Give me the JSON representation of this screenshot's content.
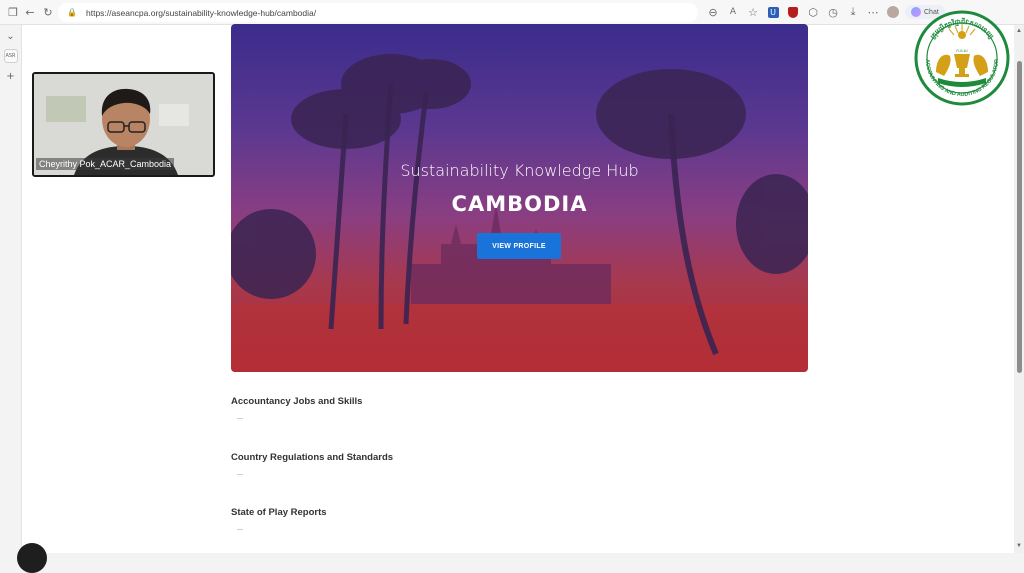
{
  "browser": {
    "url": "https://aseancpa.org/sustainability-knowledge-hub/cambodia/",
    "chat_label": "Chat",
    "toolbar_icons": [
      "tabs-icon",
      "back-icon",
      "refresh-icon",
      "lock-icon"
    ],
    "right_icons": [
      "zoom-icon",
      "read-aloud-icon",
      "favorite-icon",
      "extension-u-icon",
      "extension-shield-icon",
      "extensions-icon",
      "history-icon",
      "download-icon",
      "more-icon",
      "profile-avatar"
    ]
  },
  "sidebar": {
    "items": [
      "collapse-icon",
      "tab-thumbnail",
      "add-icon"
    ]
  },
  "video": {
    "participant_name": "Cheyrithy Pok_ACAR_Cambodia"
  },
  "hero": {
    "subtitle": "Sustainability Knowledge Hub",
    "title": "CAMBODIA",
    "button_label": "VIEW PROFILE"
  },
  "sections": [
    {
      "title": "Accountancy Jobs and Skills"
    },
    {
      "title": "Country Regulations and Standards"
    },
    {
      "title": "State of Play Reports"
    }
  ],
  "logo": {
    "top_text": "ក្រុមប្រឹក្សាវិជ្ជាជីវៈគណនេយ្យ",
    "center_text": "ក.គ.ស",
    "bottom_text": "ACCOUNTING AND AUDITING REGULATOR"
  },
  "colors": {
    "hero_top": "#3b2c8c",
    "hero_bottom": "#b02a32",
    "button": "#1a73d9",
    "logo_green": "#1e8a3c",
    "logo_gold": "#d4a017"
  }
}
